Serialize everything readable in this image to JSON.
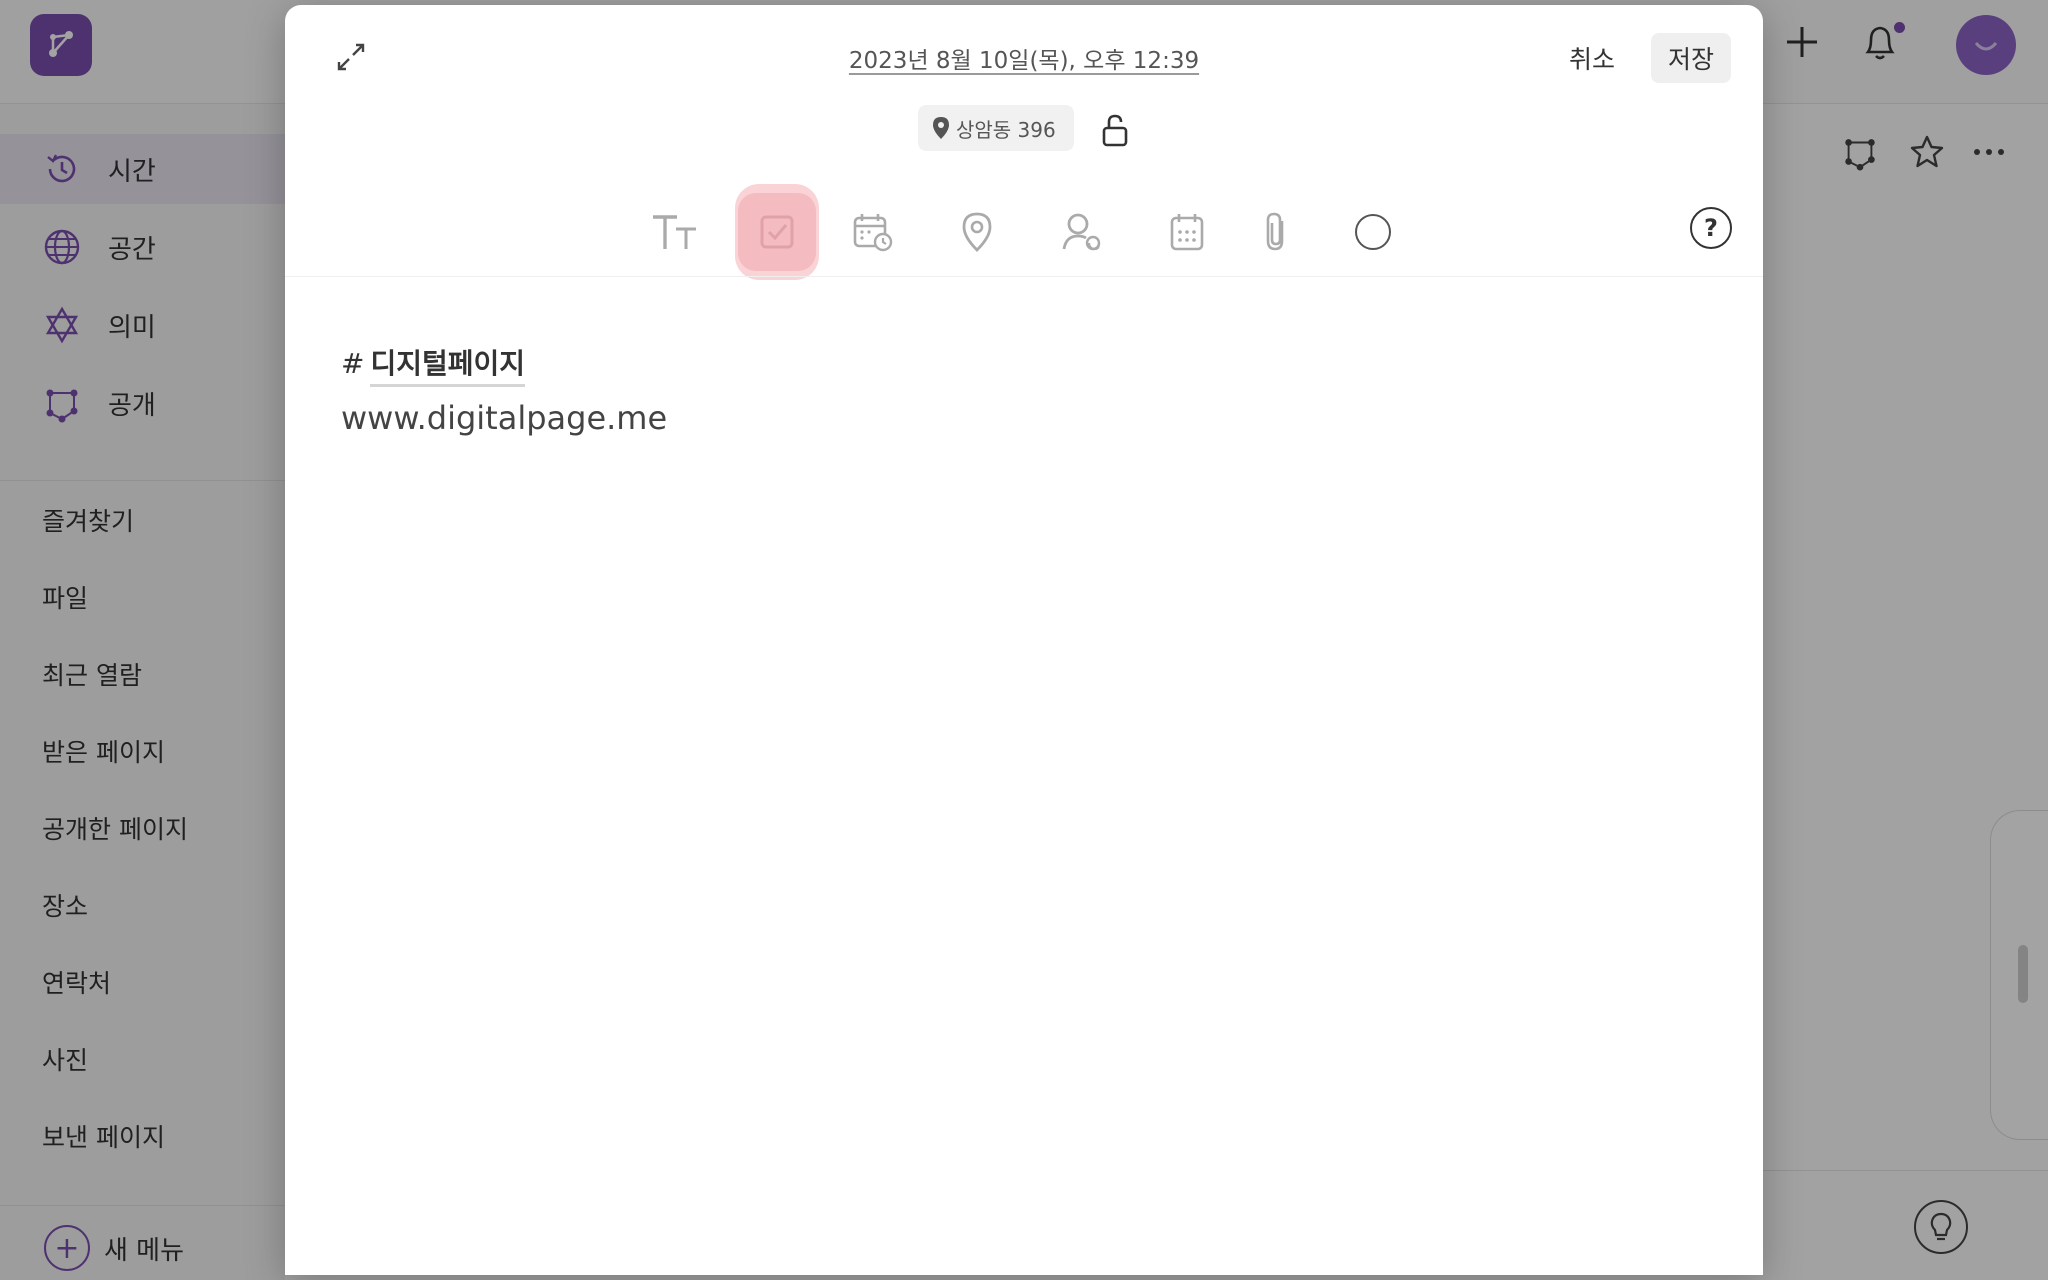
{
  "sidebar": {
    "nav": [
      {
        "label": "시간",
        "icon": "clock-history-icon"
      },
      {
        "label": "공간",
        "icon": "globe-icon"
      },
      {
        "label": "의미",
        "icon": "hexagram-icon"
      },
      {
        "label": "공개",
        "icon": "share-network-icon"
      }
    ],
    "menu": [
      "즐겨찾기",
      "파일",
      "최근 열람",
      "받은 페이지",
      "공개한 페이지",
      "장소",
      "연락처",
      "사진",
      "보낸 페이지"
    ],
    "new_menu_label": "새 메뉴"
  },
  "modal": {
    "date": "2023년 8월 10일(목), 오후 12:39",
    "cancel_label": "취소",
    "save_label": "저장",
    "location": "상암동 396",
    "help_label": "?",
    "tools": [
      "text-size-icon",
      "checkbox-icon",
      "calendar-clock-icon",
      "map-pin-icon",
      "contact-icon",
      "calendar-icon",
      "paperclip-icon",
      "color-circle-icon"
    ],
    "active_tool": "checkbox-icon",
    "content": {
      "hash": "#",
      "tag": "디지털페이지",
      "url": "www.digitalpage.me"
    }
  },
  "colors": {
    "accent": "#7b4fb0",
    "active_tool_bg": "#f4bcc1"
  }
}
